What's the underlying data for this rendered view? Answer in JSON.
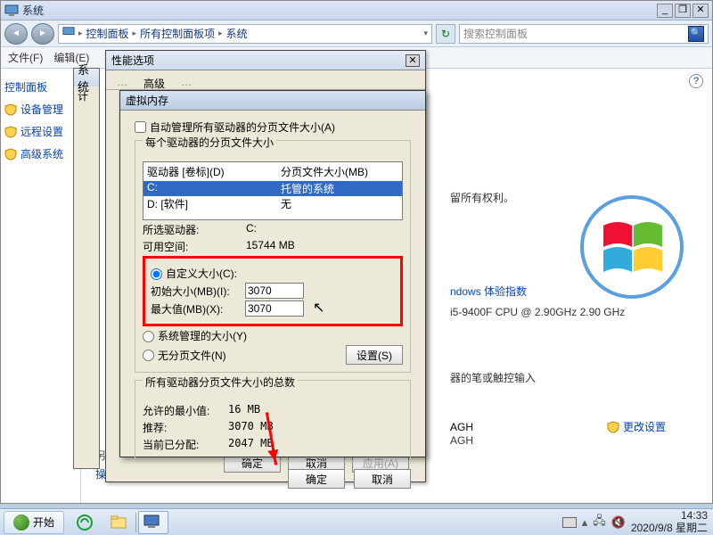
{
  "window": {
    "title": "系统",
    "minimize": "_",
    "restore": "❐",
    "close": "✕"
  },
  "nav": {
    "back": "◄",
    "fwd": "►",
    "crumb1": "控制面板",
    "crumb2": "所有控制面板项",
    "crumb3": "系统",
    "refresh": "↻",
    "search_placeholder": "搜索控制面板",
    "go": "→"
  },
  "menu": {
    "file": "文件(F)",
    "edit": "编辑(E)"
  },
  "sidebar": {
    "item0": "控制面板",
    "item1": "设备管理",
    "item2": "远程设置",
    "item3": "高级系统"
  },
  "main": {
    "rights": "留所有权利。",
    "exp_label": "ndows 体验指数",
    "cpu": "i5-9400F CPU @ 2.90GHz   2.90 GHz",
    "pen": "器的笔或触控输入",
    "wg1": "AGH",
    "wg2": "AGH",
    "change": "更改设置",
    "seealso": "另请参阅",
    "action_center": "操作中心",
    "help_q": "?"
  },
  "sysprops": {
    "title": "系统",
    "tab": "计"
  },
  "perf_dlg": {
    "title": "性能选项",
    "tab_adv": "高级",
    "close": "✕",
    "ok": "确定",
    "cancel": "取消",
    "apply": "应用(A)"
  },
  "vm_dlg": {
    "title": "虚拟内存",
    "auto_manage": "自动管理所有驱动器的分页文件大小(A)",
    "group1_legend": "每个驱动器的分页文件大小",
    "hdr_drive": "驱动器 [卷标](D)",
    "hdr_size": "分页文件大小(MB)",
    "drive_c": "C:",
    "drive_c_val": "托管的系统",
    "drive_d": "D:   [软件]",
    "drive_d_val": "无",
    "selected_label": "所选驱动器:",
    "selected_val": "C:",
    "avail_label": "可用空间:",
    "avail_val": "15744 MB",
    "custom": "自定义大小(C):",
    "initial": "初始大小(MB)(I):",
    "initial_val": "3070",
    "max": "最大值(MB)(X):",
    "max_val": "3070",
    "sys_managed": "系统管理的大小(Y)",
    "none": "无分页文件(N)",
    "set_btn": "设置(S)",
    "totals_legend": "所有驱动器分页文件大小的总数",
    "min_label": "允许的最小值:",
    "min_val": "16 MB",
    "rec_label": "推荐:",
    "rec_val": "3070 MB",
    "cur_label": "当前已分配:",
    "cur_val": "2047 MB",
    "ok": "确定",
    "cancel": "取消"
  },
  "taskbar": {
    "start": "开始",
    "time": "14:33",
    "date": "2020/9/8 星期二"
  }
}
